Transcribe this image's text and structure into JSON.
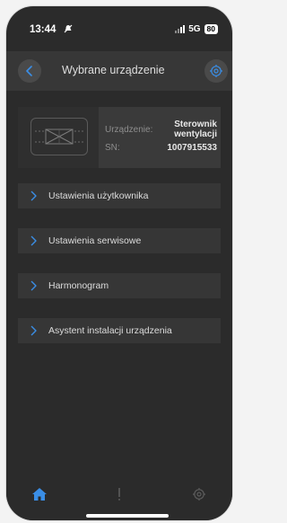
{
  "status": {
    "time": "13:44",
    "network": "5G",
    "battery": "80"
  },
  "header": {
    "title": "Wybrane urządzenie",
    "back_icon": "chevron-left-icon",
    "settings_icon": "gear-icon"
  },
  "device": {
    "label_device": "Urządzenie:",
    "value_device_line1": "Sterownik",
    "value_device_line2": "wentylacji",
    "label_sn": "SN:",
    "value_sn": "1007915533",
    "image_icon": "ventilation-unit-icon"
  },
  "menu": [
    {
      "label": "Ustawienia użytkownika"
    },
    {
      "label": "Ustawienia serwisowe"
    },
    {
      "label": "Harmonogram"
    },
    {
      "label": "Asystent instalacji urządzenia"
    }
  ],
  "tabbar": {
    "home": "home-icon",
    "alerts": "exclamation-icon",
    "settings": "gear-icon"
  },
  "colors": {
    "accent": "#3a8ee6",
    "background": "#2b2b2b",
    "panel": "#363636",
    "muted": "#5c5c5c"
  }
}
